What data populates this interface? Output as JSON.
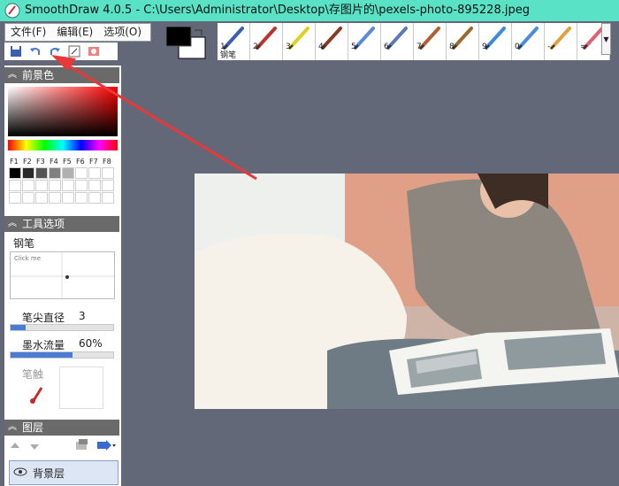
{
  "window": {
    "title": "SmoothDraw 4.0.5 - C:\\Users\\Administrator\\Desktop\\存图片的\\pexels-photo-895228.jpeg"
  },
  "menu": {
    "items": [
      "文件(F)",
      "编辑(E)",
      "选项(O)"
    ]
  },
  "brushes": [
    {
      "num": "1",
      "label": "钢笔",
      "color": "#3a5fb0"
    },
    {
      "num": "2",
      "label": "",
      "color": "#c0302a"
    },
    {
      "num": "3",
      "label": "",
      "color": "#e0d020"
    },
    {
      "num": "4",
      "label": "",
      "color": "#8a3a20"
    },
    {
      "num": "5",
      "label": "",
      "color": "#5a8ad8"
    },
    {
      "num": "6",
      "label": "",
      "color": "#5a7ab8"
    },
    {
      "num": "7",
      "label": "",
      "color": "#b06030"
    },
    {
      "num": "8",
      "label": "",
      "color": "#9a6a30"
    },
    {
      "num": "9",
      "label": "",
      "color": "#3a8ae0"
    },
    {
      "num": "0",
      "label": "",
      "color": "#4a8ae0"
    },
    {
      "num": "-",
      "label": "",
      "color": "#e0a040"
    },
    {
      "num": "=",
      "label": "",
      "color": "#e06070"
    }
  ],
  "panels": {
    "foreground": "前景色",
    "tool_options": "工具选项",
    "layers": "图层"
  },
  "color_keys": [
    "F1",
    "F2",
    "F3",
    "F4",
    "F5",
    "F6",
    "F7",
    "F8"
  ],
  "swatch_colors": [
    "#000000",
    "#2a2a2a",
    "#555555",
    "#808080",
    "#b0b0b0",
    "#ffffff",
    "#ffffff",
    "#ffffff"
  ],
  "tool": {
    "name": "钢笔",
    "click_hint": "Click me",
    "tip_size_label": "笔尖直径",
    "tip_size_value": "3",
    "tip_size_level": 0.15,
    "ink_flow_label": "墨水流量",
    "ink_flow_value": "60%",
    "ink_flow_level": 0.6,
    "pressure_label": "笔触"
  },
  "layer": {
    "name": "背景层"
  }
}
